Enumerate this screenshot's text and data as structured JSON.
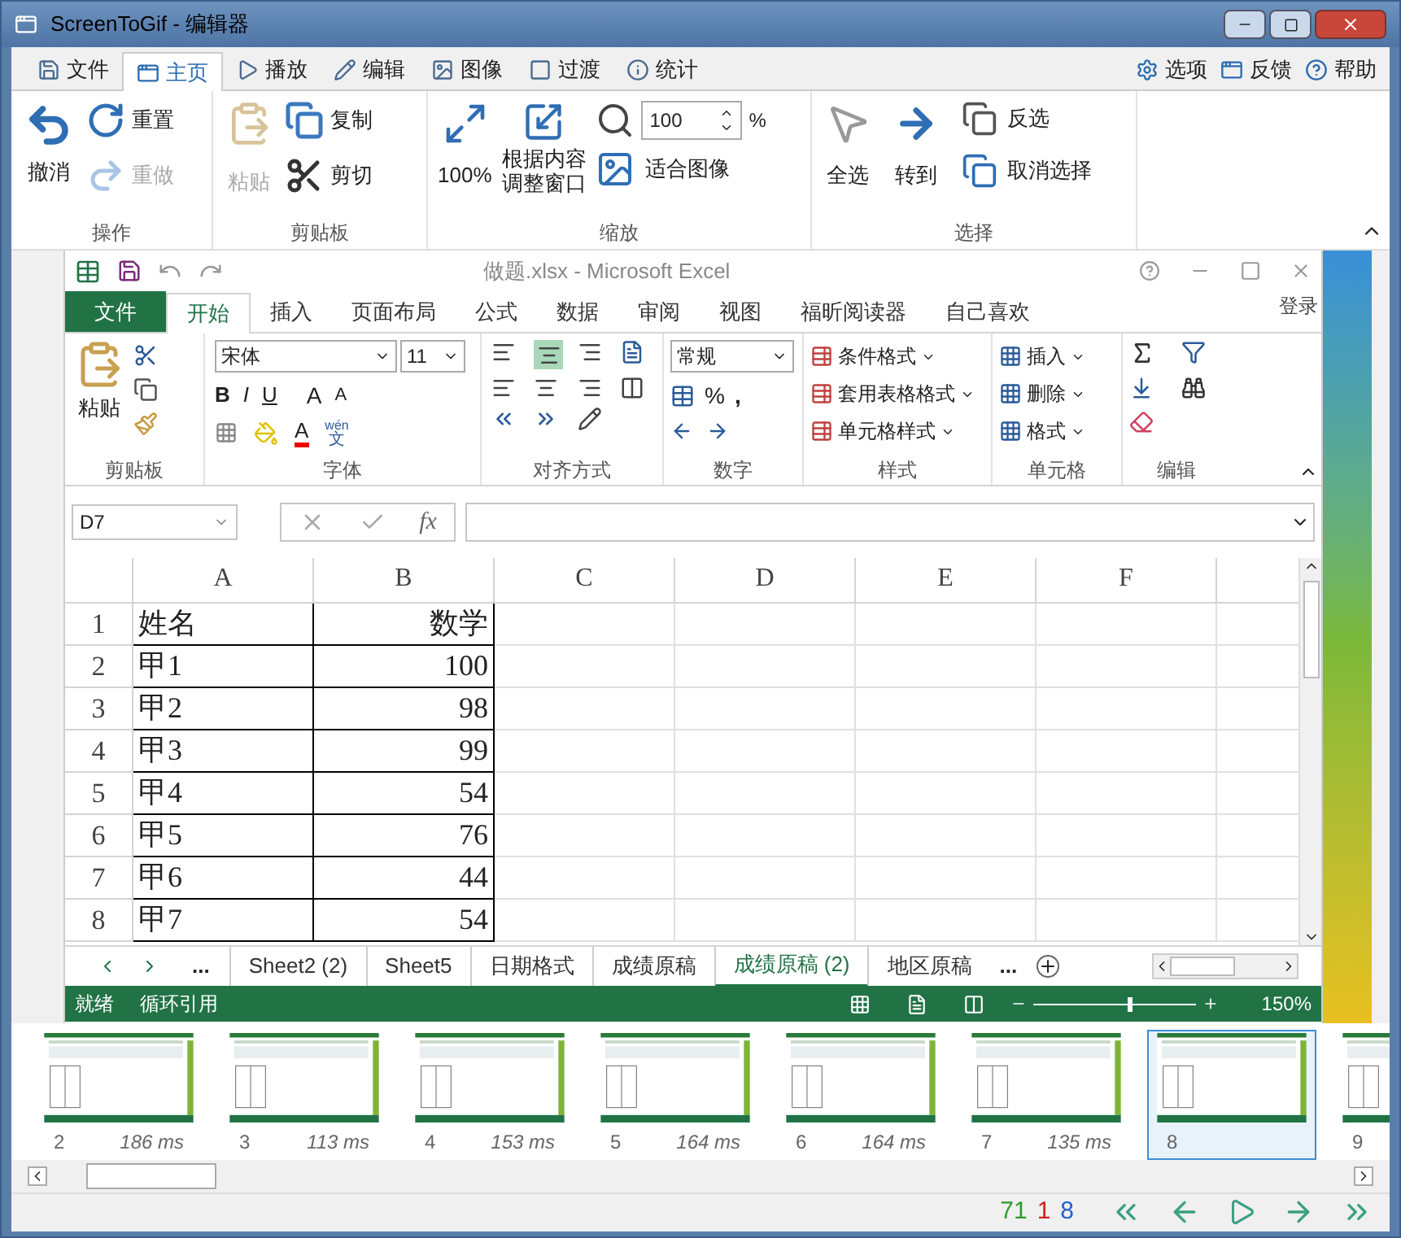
{
  "window": {
    "title": "ScreenToGif - 编辑器"
  },
  "tabs": [
    {
      "label": "文件",
      "selected": false,
      "kind": "file"
    },
    {
      "label": "主页",
      "selected": true,
      "kind": "home"
    },
    {
      "label": "播放",
      "selected": false,
      "kind": "play"
    },
    {
      "label": "编辑",
      "selected": false,
      "kind": "edit"
    },
    {
      "label": "图像",
      "selected": false,
      "kind": "image"
    },
    {
      "label": "过渡",
      "selected": false,
      "kind": "transition"
    },
    {
      "label": "统计",
      "selected": false,
      "kind": "stats"
    }
  ],
  "top_links": [
    {
      "label": "选项",
      "kind": "options"
    },
    {
      "label": "反馈",
      "kind": "feedback"
    },
    {
      "label": "帮助",
      "kind": "help"
    }
  ],
  "ribbon": {
    "actions": {
      "label": "操作",
      "undo": {
        "label": "撤消",
        "disabled": false
      },
      "reset": {
        "label": "重置",
        "disabled": false
      },
      "redo": {
        "label": "重做",
        "disabled": true
      }
    },
    "clipboard": {
      "label": "剪贴板",
      "paste": {
        "label": "粘贴",
        "disabled": true
      },
      "copy": {
        "label": "复制",
        "disabled": false
      },
      "cut": {
        "label": "剪切",
        "disabled": false
      }
    },
    "zoom": {
      "label": "缩放",
      "actual": "100%",
      "fit_window": [
        "根据内容",
        "调整窗口"
      ],
      "value": "100",
      "unit": "%",
      "fit_image": "适合图像"
    },
    "select": {
      "label": "选择",
      "all": "全选",
      "goto": "转到",
      "invert": "反选",
      "none": "取消选择"
    }
  },
  "excel": {
    "title": "做题.xlsx - Microsoft Excel",
    "file_tab": "文件",
    "tabs": [
      {
        "label": "开始",
        "selected": true
      },
      {
        "label": "插入",
        "selected": false
      },
      {
        "label": "页面布局",
        "selected": false
      },
      {
        "label": "公式",
        "selected": false
      },
      {
        "label": "数据",
        "selected": false
      },
      {
        "label": "审阅",
        "selected": false
      },
      {
        "label": "视图",
        "selected": false
      },
      {
        "label": "福昕阅读器",
        "selected": false
      },
      {
        "label": "自己喜欢",
        "selected": false
      }
    ],
    "login": "登录",
    "clipboard": {
      "label": "剪贴板",
      "paste": "粘贴"
    },
    "font": {
      "label": "字体",
      "name": "宋体",
      "size": "11",
      "styles": [
        "B",
        "I",
        "U"
      ],
      "grow": "A",
      "shrink": "A",
      "color_letter": "A",
      "phonetic": "wén",
      "phonetic_char": "文"
    },
    "alignment": {
      "label": "对齐方式"
    },
    "number": {
      "label": "数字",
      "format": "常规",
      "percent": "%",
      "comma": ","
    },
    "styles": {
      "label": "样式",
      "items": [
        "条件格式",
        "套用表格格式",
        "单元格样式"
      ]
    },
    "cells": {
      "label": "单元格",
      "items": [
        "插入",
        "删除",
        "格式"
      ]
    },
    "editing": {
      "label": "编辑"
    },
    "name_box": "D7",
    "fx": "fx",
    "columns": [
      "A",
      "B",
      "C",
      "D",
      "E",
      "F"
    ],
    "rows": [
      {
        "number": "1",
        "cells": [
          "姓名",
          "数学"
        ]
      },
      {
        "number": "2",
        "cells": [
          "甲1",
          "100"
        ]
      },
      {
        "number": "3",
        "cells": [
          "甲2",
          "98"
        ]
      },
      {
        "number": "4",
        "cells": [
          "甲3",
          "99"
        ]
      },
      {
        "number": "5",
        "cells": [
          "甲4",
          "54"
        ]
      },
      {
        "number": "6",
        "cells": [
          "甲5",
          "76"
        ]
      },
      {
        "number": "7",
        "cells": [
          "甲6",
          "44"
        ]
      },
      {
        "number": "8",
        "cells": [
          "甲7",
          "54"
        ]
      }
    ],
    "sheet_more": "...",
    "sheets": [
      {
        "label": "Sheet2 (2)",
        "selected": false
      },
      {
        "label": "Sheet5",
        "selected": false
      },
      {
        "label": "日期格式",
        "selected": false
      },
      {
        "label": "成绩原稿",
        "selected": false
      },
      {
        "label": "成绩原稿 (2)",
        "selected": true
      },
      {
        "label": "地区原稿",
        "selected": false
      }
    ],
    "sheet_more_right": "...",
    "status": [
      "就绪",
      "循环引用"
    ],
    "zoom_slider": {
      "level": 0.58
    },
    "zoom": "150%"
  },
  "frames": [
    {
      "number": "2",
      "time": "186 ms",
      "selected": false
    },
    {
      "number": "3",
      "time": "113 ms",
      "selected": false
    },
    {
      "number": "4",
      "time": "153 ms",
      "selected": false
    },
    {
      "number": "5",
      "time": "164 ms",
      "selected": false
    },
    {
      "number": "6",
      "time": "164 ms",
      "selected": false
    },
    {
      "number": "7",
      "time": "135 ms",
      "selected": false
    },
    {
      "number": "8",
      "selected": true
    },
    {
      "number": "9",
      "selected": false
    }
  ],
  "counters": [
    {
      "value": "71",
      "color": "#2e9b2e"
    },
    {
      "value": "1",
      "color": "#d02020"
    },
    {
      "value": "8",
      "color": "#2060d0"
    }
  ]
}
